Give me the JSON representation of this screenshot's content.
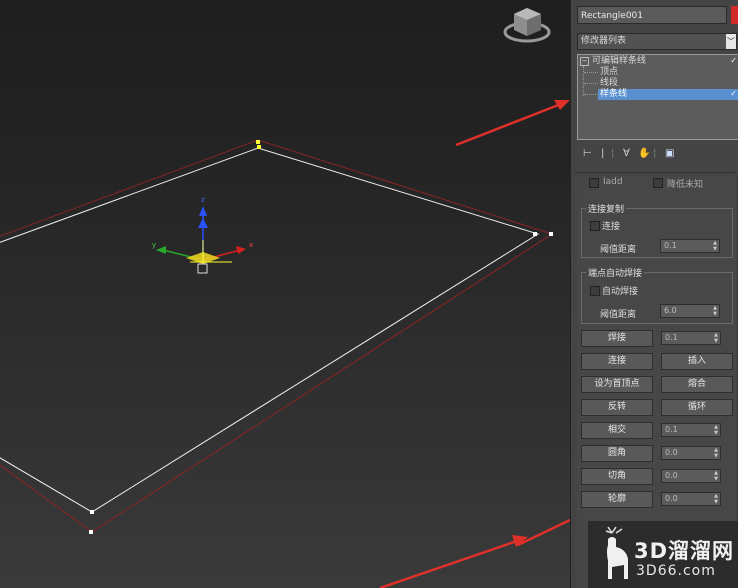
{
  "object_name": "Rectangle001",
  "colors": {
    "accent_red": "#e0302a",
    "selection_blue": "#5a8fd0",
    "spline_white": "#ffffff",
    "outline_red": "#9c2a2a"
  },
  "modifier_list": {
    "label": "修改器列表",
    "dropdown_icon": "chevron-down-icon"
  },
  "stack": {
    "root": "可编辑样条线",
    "children": [
      "顶点",
      "线段",
      "样条线"
    ],
    "selected": "样条线"
  },
  "toolbar": {
    "icons": [
      "pin-stack-icon",
      "show-end-result-icon",
      "make-unique-icon",
      "remove-modifier-icon",
      "configure-sets-icon"
    ]
  },
  "partial_row": {
    "left": "Iadd",
    "right": "降低未知"
  },
  "connect_copy": {
    "title": "连接复制",
    "checkbox_label": "连接",
    "threshold_label": "阈值距离",
    "threshold_value": "0.1"
  },
  "end_weld": {
    "title": "端点自动焊接",
    "checkbox_label": "自动焊接",
    "threshold_label": "阈值距离",
    "threshold_value": "6.0"
  },
  "geometry_buttons": {
    "weld": "焊接",
    "weld_value": "0.1",
    "connect": "连接",
    "insert": "插入",
    "make_first": "设为首顶点",
    "fuse": "熔合",
    "reverse": "反转",
    "cycle": "循环",
    "cross_insert": "相交",
    "cross_insert_value": "0.1",
    "fillet": "圆角",
    "fillet_value": "0.0",
    "chamfer": "切角",
    "chamfer_value": "0.0",
    "outline": "轮廓",
    "outline_value": "0.0"
  },
  "gizmo": {
    "x_label": "x",
    "y_label": "y",
    "z_label": "z"
  },
  "watermark": {
    "cn": "3D溜溜网",
    "en": "3D66.com"
  }
}
